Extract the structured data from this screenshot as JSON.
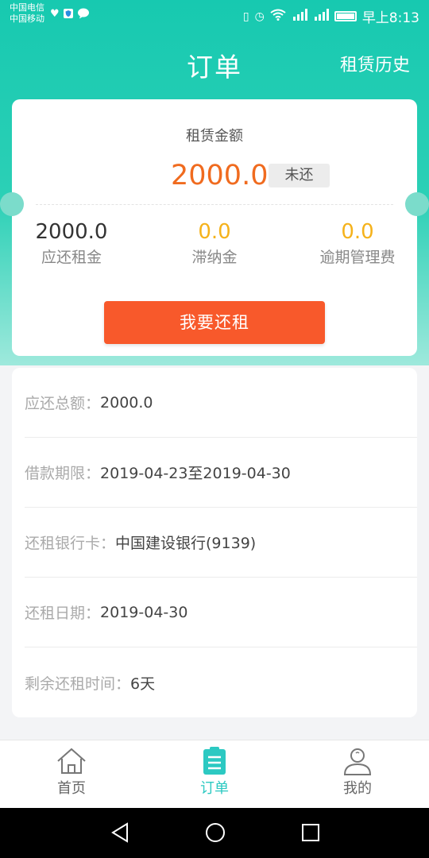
{
  "status_bar": {
    "carrier_1": "中国电信",
    "carrier_2": "中国移动",
    "time": "早上8:13",
    "icons": [
      "heart-icon",
      "shield-icon",
      "chat-icon",
      "vibrate-icon",
      "alarm-icon",
      "wifi-icon",
      "signal-icon",
      "signal-icon",
      "battery-icon"
    ]
  },
  "header": {
    "title": "订单",
    "right_link": "租赁历史"
  },
  "summary": {
    "label": "租赁金额",
    "amount": "2000.0",
    "status": "未还",
    "stats": [
      {
        "value": "2000.0",
        "label": "应还租金"
      },
      {
        "value": "0.0",
        "label": "滞纳金"
      },
      {
        "value": "0.0",
        "label": "逾期管理费"
      }
    ],
    "pay_button": "我要还租"
  },
  "details": [
    {
      "key": "应还总额：",
      "value": "2000.0"
    },
    {
      "key": "借款期限：",
      "value": "2019-04-23至2019-04-30"
    },
    {
      "key": "还租银行卡：",
      "value": "中国建设银行(9139)"
    },
    {
      "key": "还租日期：",
      "value": "2019-04-30"
    },
    {
      "key": "剩余还租时间：",
      "value": "6天"
    }
  ],
  "tabbar": {
    "items": [
      {
        "label": "首页",
        "icon": "home-icon",
        "active": false
      },
      {
        "label": "订单",
        "icon": "order-icon",
        "active": true
      },
      {
        "label": "我的",
        "icon": "profile-icon",
        "active": false
      }
    ]
  },
  "colors": {
    "brand": "#1ec8b0",
    "accent": "#f8592b",
    "amount": "#f06b1f",
    "fee": "#f5b21b",
    "active_tab": "#2cc9c2"
  }
}
